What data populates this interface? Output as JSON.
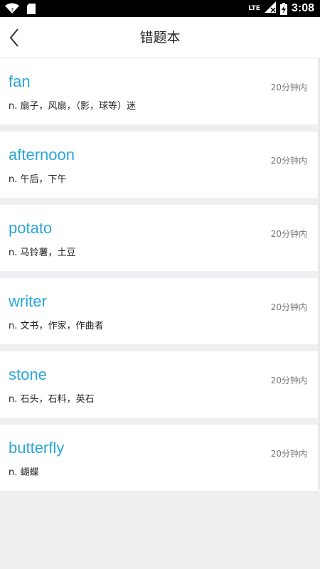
{
  "status_bar": {
    "network": "LTE",
    "clock": "3:08"
  },
  "header": {
    "title": "错题本"
  },
  "words": [
    {
      "word": "fan",
      "meaning": "n. 扇子，风扇，（影，球等）迷",
      "time": "20分钟内"
    },
    {
      "word": "afternoon",
      "meaning": "n. 午后，下午",
      "time": "20分钟内"
    },
    {
      "word": "potato",
      "meaning": "n. 马铃薯，土豆",
      "time": "20分钟内"
    },
    {
      "word": "writer",
      "meaning": "n. 文书，作家，作曲者",
      "time": "20分钟内"
    },
    {
      "word": "stone",
      "meaning": "n. 石头，石料，英石",
      "time": "20分钟内"
    },
    {
      "word": "butterfly",
      "meaning": "n. 蝴蝶",
      "time": "20分钟内"
    }
  ],
  "colors": {
    "accent": "#2aa7d8",
    "background": "#efeff1",
    "status_bar": "#000000"
  },
  "icons": [
    "wifi-icon",
    "sd-card-icon",
    "signal-icon",
    "battery-icon",
    "back-arrow-icon"
  ]
}
